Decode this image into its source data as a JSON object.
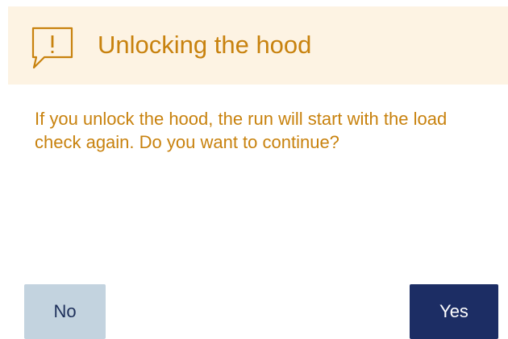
{
  "dialog": {
    "title": "Unlocking the hood",
    "message": "If you unlock the hood, the run will start with the load check again. Do you want to continue?",
    "icon": "warning-speech-bubble-icon",
    "no_label": "No",
    "yes_label": "Yes"
  },
  "colors": {
    "header_background": "#fdf3e3",
    "warning_text": "#c8820e",
    "secondary_button": "#c3d3df",
    "primary_button": "#1c2d64"
  }
}
